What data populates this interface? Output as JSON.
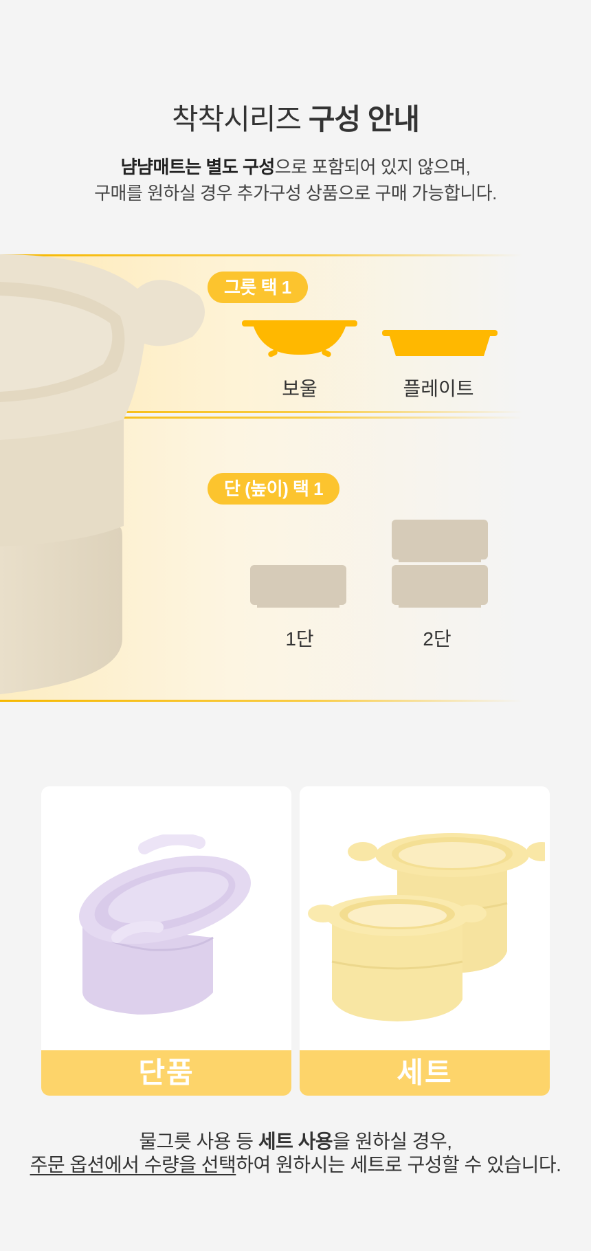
{
  "title": {
    "normal": "착착시리즈 ",
    "bold": "구성 안내"
  },
  "subtitle": {
    "line1_bold": "냠냠매트는 별도 구성",
    "line1_rest": "으로 포함되어 있지 않으며,",
    "line2": "구매를 원하실 경우 추가구성 상품으로 구매 가능합니다."
  },
  "section_container": {
    "pill": "그릇 택 1",
    "options": [
      {
        "label": "보울",
        "icon": "bowl-icon"
      },
      {
        "label": "플레이트",
        "icon": "plate-icon"
      }
    ]
  },
  "section_tier": {
    "pill": "단 (높이) 택 1",
    "options": [
      {
        "label": "1단",
        "icon": "one-tier-icon"
      },
      {
        "label": "2단",
        "icon": "two-tier-icon"
      }
    ]
  },
  "cards": [
    {
      "label": "단품"
    },
    {
      "label": "세트"
    }
  ],
  "note": {
    "line1_a": "물그릇 사용 등 ",
    "line1_bold": "세트 사용",
    "line1_b": "을 원하실 경우,",
    "line2_underline": "주문 옵션에서 수량을 선택",
    "line2_rest": "하여 원하시는 세트로 구성할 수 있습니다."
  },
  "colors": {
    "accent": "#fcc42e",
    "accent_line": "#f6b800",
    "band_bg": "#fde9b6",
    "tier_block": "#d6cbb8",
    "card_footer": "#fdd46a",
    "bowl_cream": "#ece3d0",
    "lavender": "#ddd0ec",
    "pale_yellow": "#f9e7a6"
  }
}
